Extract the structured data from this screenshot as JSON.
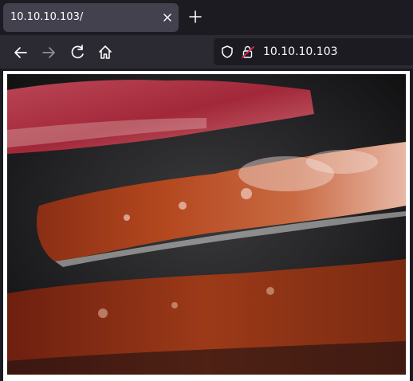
{
  "tab": {
    "title": "10.10.10.103/"
  },
  "address_bar": {
    "url": "10.10.10.103"
  },
  "icons": {
    "close_tab": "close-icon",
    "new_tab": "plus-icon",
    "back": "arrow-left-icon",
    "forward": "arrow-right-icon",
    "reload": "reload-icon",
    "home": "home-icon",
    "tracking": "shield-icon",
    "insecure": "lock-warning-icon"
  },
  "colors": {
    "tab_bar": "#1c1b22",
    "tab_active": "#42414d",
    "toolbar": "#2b2a33",
    "text": "#fbfbfe",
    "insecure_accent": "#e22850"
  },
  "page": {
    "image_subject": "bacon"
  }
}
